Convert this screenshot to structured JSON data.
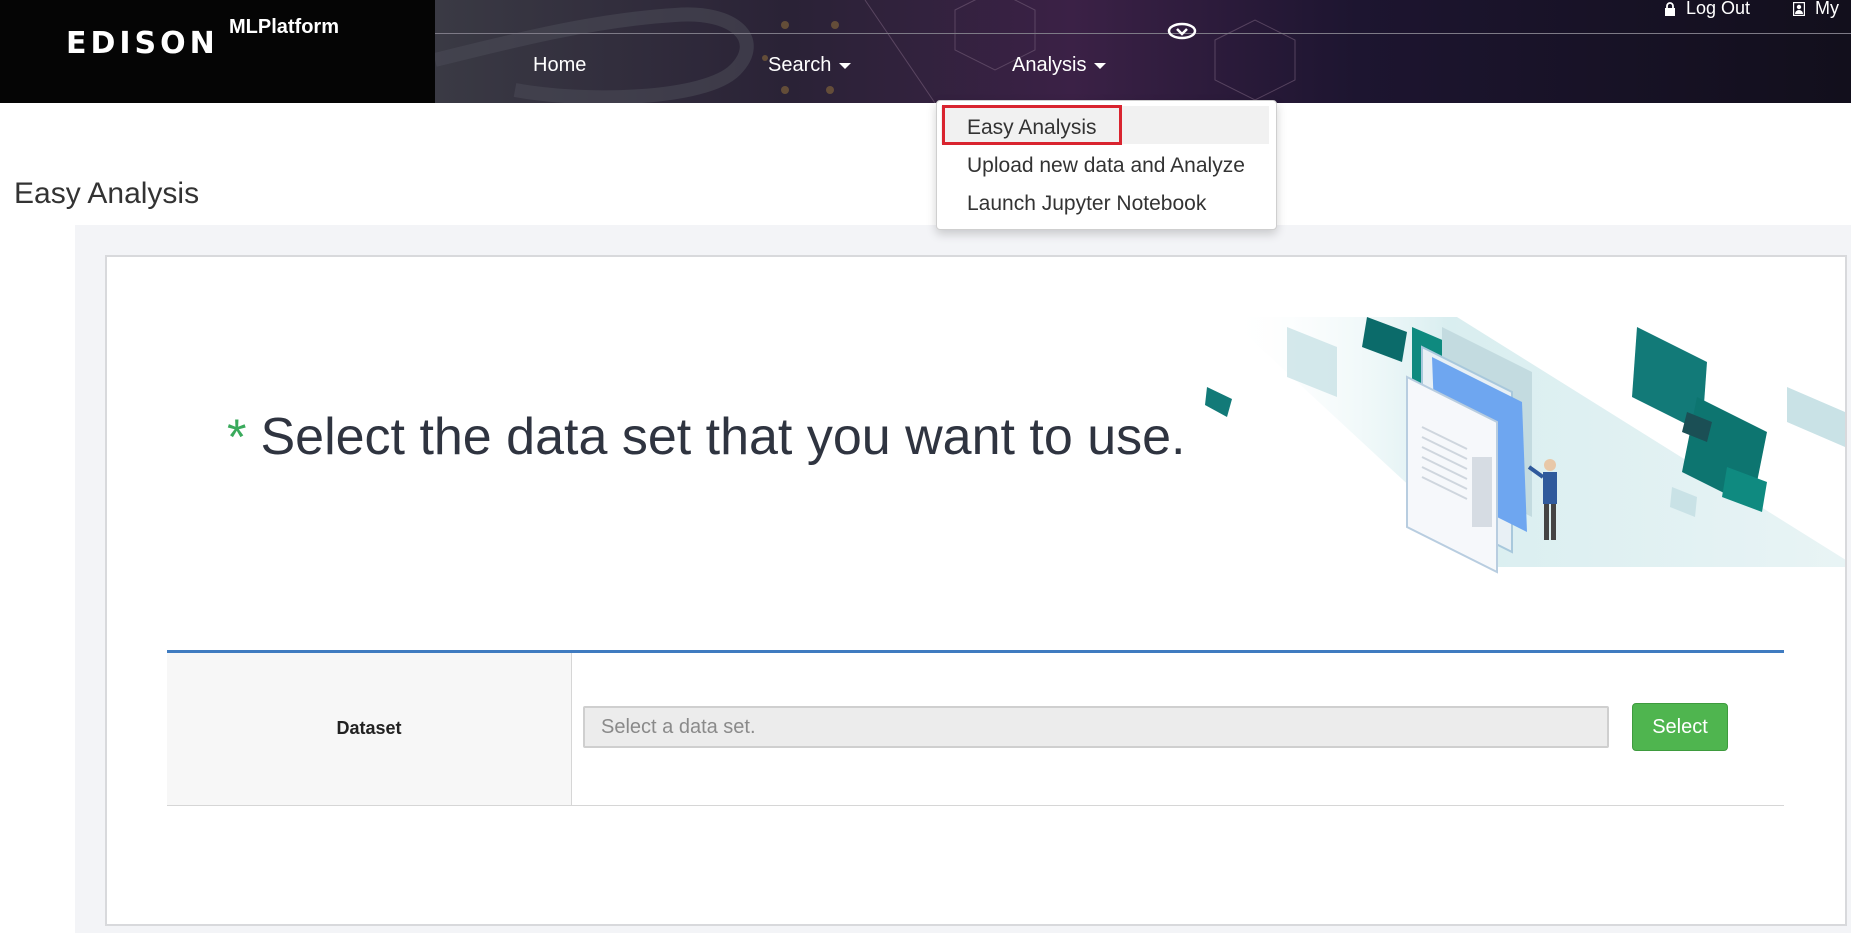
{
  "header": {
    "logo_text": "EDISON",
    "brand": "MLPlatform",
    "nav": [
      {
        "label": "Home",
        "has_caret": false
      },
      {
        "label": "Search",
        "has_caret": true
      },
      {
        "label": "Analysis",
        "has_caret": true
      }
    ],
    "utility": {
      "logout_label": "Log Out",
      "my_label": "My"
    }
  },
  "dropdown": {
    "items": [
      {
        "label": "Easy Analysis",
        "highlighted": true
      },
      {
        "label": "Upload new data and Analyze"
      },
      {
        "label": "Launch Jupyter Notebook"
      }
    ]
  },
  "page": {
    "title": "Easy Analysis"
  },
  "hero": {
    "asterisk": "*",
    "text": "Select the data set that you want to use."
  },
  "form": {
    "dataset_label": "Dataset",
    "dataset_placeholder": "Select a data set.",
    "dataset_value": "",
    "select_button": "Select"
  },
  "colors": {
    "accent_green": "#4fb54f",
    "asterisk_green": "#3aaa5c",
    "table_border_blue": "#3f7bc0",
    "highlight_red": "#d9242f"
  },
  "icons": [
    "lock-icon",
    "user-icon",
    "menu-toggle-icon",
    "caret-down-icon"
  ]
}
